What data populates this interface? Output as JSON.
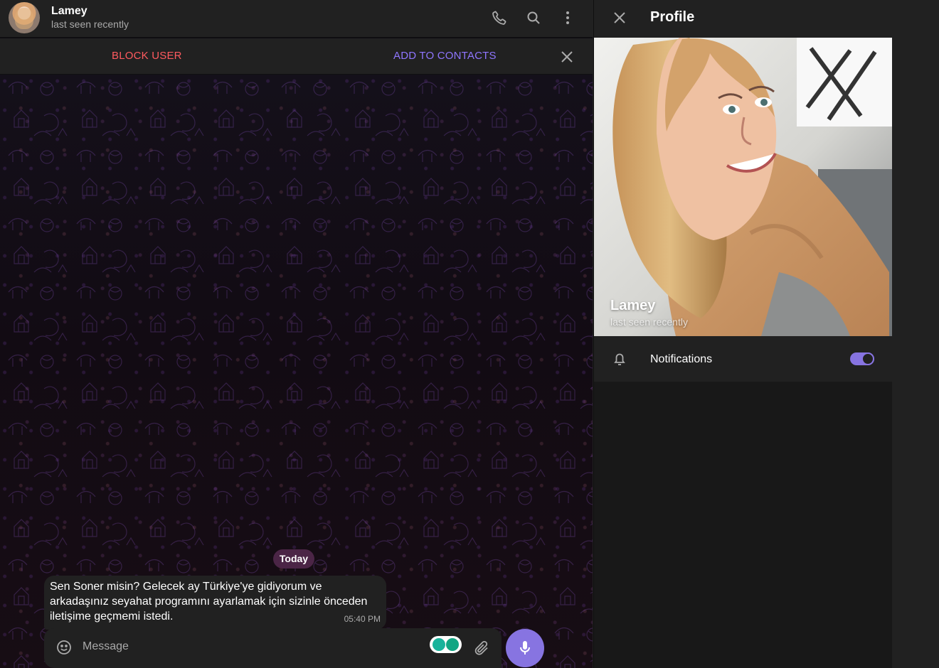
{
  "chat": {
    "peer_name": "Lamey",
    "peer_status": "last seen recently",
    "actions": {
      "block_user": "BLOCK USER",
      "add_to_contacts": "ADD TO CONTACTS"
    },
    "date_chip": "Today",
    "message": {
      "text": "Sen Soner misin? Gelecek ay Türkiye'ye gidiyorum ve arkadaşınız seyahat programını ayarlamak için sizinle önceden iletişime geçmemi istedi.",
      "time": "05:40 PM"
    },
    "composer": {
      "placeholder": "Message"
    },
    "icons": [
      "phone-icon",
      "search-icon",
      "more-vertical-icon",
      "close-icon",
      "emoji-icon",
      "attachment-icon",
      "microphone-icon"
    ],
    "colors": {
      "block": "#ff5a5f",
      "accent": "#8774e1",
      "date_chip": "#4b2546"
    }
  },
  "profile": {
    "title": "Profile",
    "name": "Lamey",
    "status": "last seen recently",
    "notifications_label": "Notifications",
    "notifications_enabled": true
  }
}
